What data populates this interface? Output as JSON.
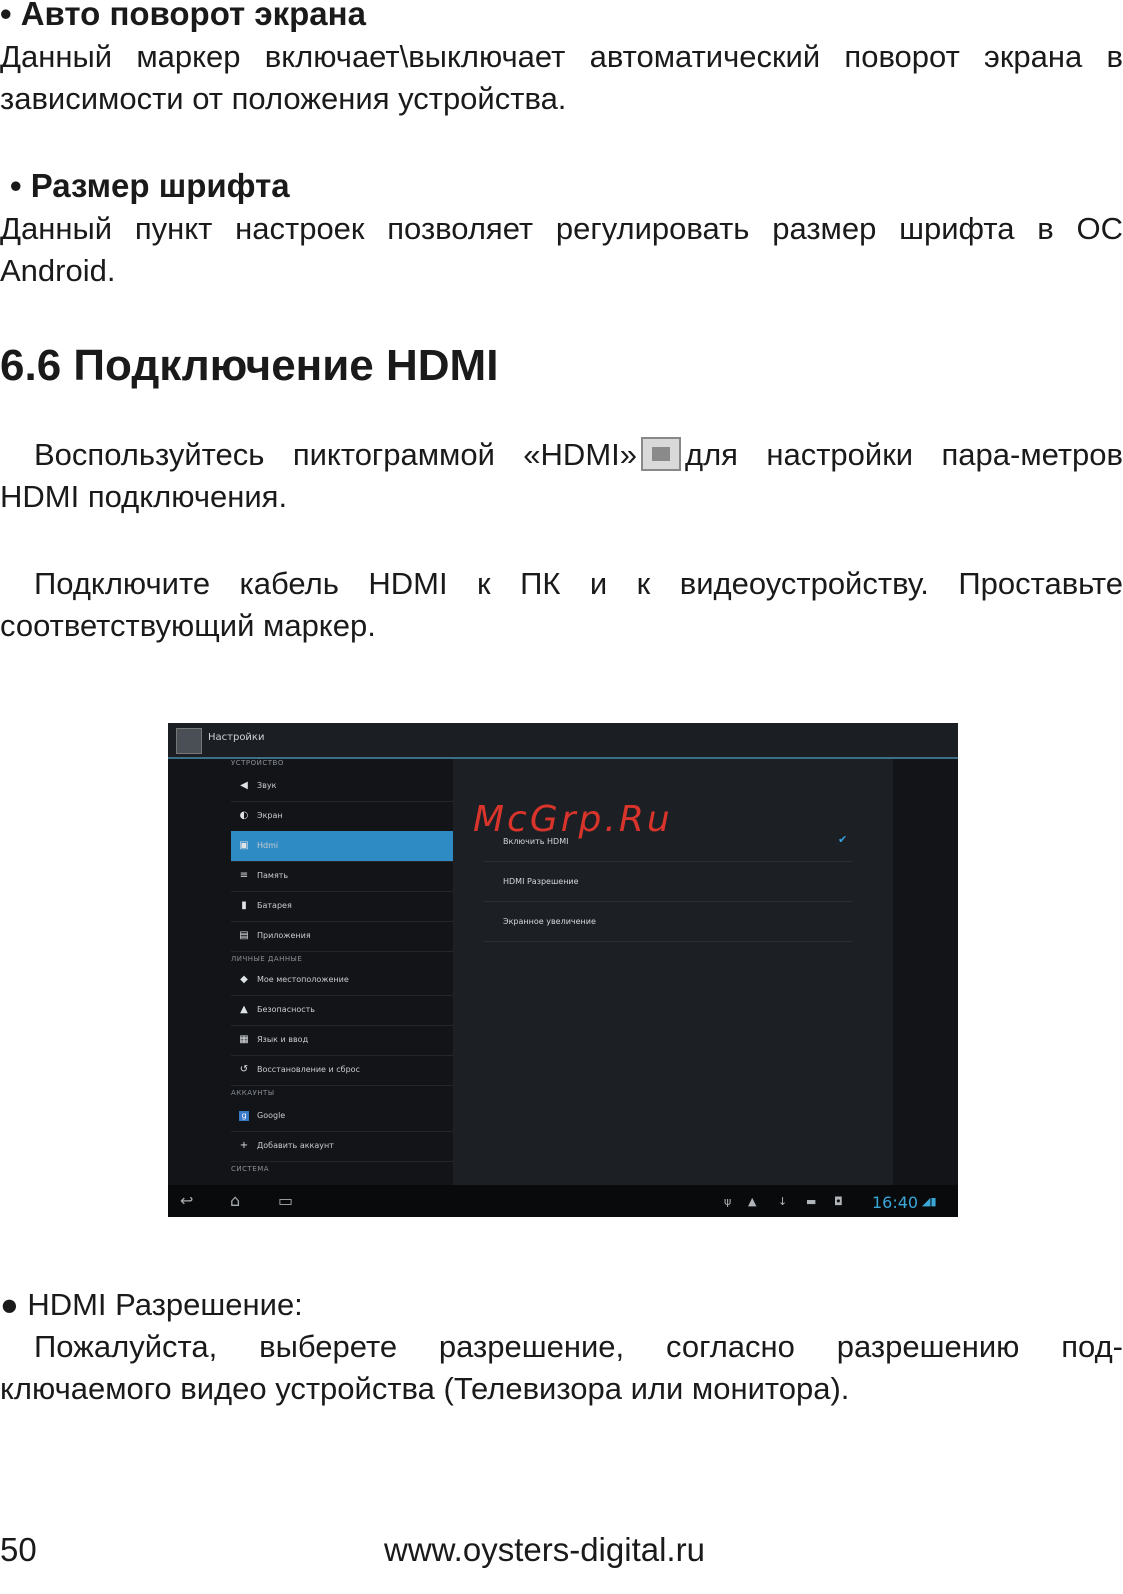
{
  "sections": {
    "auto_rotate": {
      "title": "• Авто поворот экрана",
      "text": "Данный маркер включает\\выключает автоматический поворот экрана в зависимости от положения устройства."
    },
    "font_size": {
      "title": "• Размер шрифта",
      "text": "Данный пункт настроек позволяет регулировать размер шрифта в ОС Android."
    }
  },
  "heading": "6.6 Подключение HDMI",
  "hdmi_intro": {
    "before": "Воспользуйтесь пиктограммой «HDMI»",
    "after": "для настройки пара-метров HDMI подключения."
  },
  "connect_text": "Подключите кабель HDMI к ПК и к видеоустройству. Проставьте соответствующий маркер.",
  "screenshot": {
    "app_title": "Настройки",
    "sections": [
      "УСТРОЙСТВО",
      "ЛИЧНЫЕ ДАННЫЕ",
      "АККАУНТЫ",
      "СИСТЕМА"
    ],
    "items": [
      {
        "label": "Звук",
        "icon": "speaker-icon"
      },
      {
        "label": "Экран",
        "icon": "brightness-icon"
      },
      {
        "label": "Hdmi",
        "icon": "hdmi-icon"
      },
      {
        "label": "Память",
        "icon": "storage-icon"
      },
      {
        "label": "Батарея",
        "icon": "battery-icon"
      },
      {
        "label": "Приложения",
        "icon": "apps-icon"
      },
      {
        "label": "Мое местоположение",
        "icon": "location-icon"
      },
      {
        "label": "Безопасность",
        "icon": "lock-icon"
      },
      {
        "label": "Язык и ввод",
        "icon": "keyboard-icon"
      },
      {
        "label": "Восстановление и сброс",
        "icon": "reset-icon"
      },
      {
        "label": "Google",
        "icon": "google-icon"
      },
      {
        "label": "Добавить аккаунт",
        "icon": "plus-icon"
      }
    ],
    "options": [
      "Включить HDMI",
      "HDMI Разрешение",
      "Экранное увеличение"
    ],
    "enable_hdmi_checked": true,
    "watermark": "McGrp.Ru",
    "clock": "16:40",
    "accent": "#2f8bc4"
  },
  "resolution": {
    "title": "● HDMI Разрешение:",
    "text": "Пожалуйста, выберете разрешение, согласно разрешению под-ключаемого видео устройства (Телевизора или монитора)."
  },
  "footer": {
    "page_number": "50",
    "url": "www.oysters-digital.ru"
  }
}
